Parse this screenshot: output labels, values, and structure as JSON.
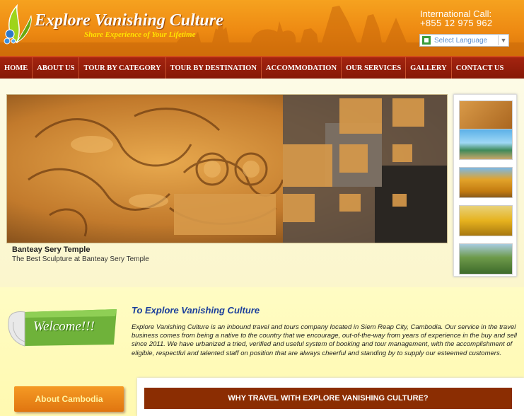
{
  "header": {
    "logo_title": "Explore Vanishing Culture",
    "tagline": "Share Experience of Your Lifetime",
    "intl_call_label": "International Call:",
    "intl_phone": "+855 12 975 962",
    "language_select_label": "Select Language"
  },
  "nav": {
    "items": [
      "HOME",
      "ABOUT US",
      "TOUR BY CATEGORY",
      "TOUR BY DESTINATION",
      "ACCOMMODATION",
      "OUR SERVICES",
      "GALLERY",
      "CONTACT US"
    ]
  },
  "slideshow": {
    "caption_title": "Banteay Sery Temple",
    "caption_subtitle": "The Best Sculpture at Banteay Sery Temple",
    "thumbnails": [
      "sculpture",
      "beach",
      "pagoda",
      "reclining-buddha",
      "green-hills"
    ]
  },
  "welcome": {
    "badge_text": "Welcome!!!",
    "title": "To Explore Vanishing Culture",
    "body": "Explore Vanishing Culture is an inbound travel and tours company located in Siem Reap City, Cambodia. Our service in the travel business comes from being a native to the country that we encourage, out-of-the-way from years of experience in the buy and sell since 2011. We have urbanized a tried, verified and useful system of booking and tour management, with the accomplishment of eligible, respectful and talented staff on position that are always cheerful and standing by to supply our esteemed customers."
  },
  "sidebar": {
    "about_cambodia_label": "About Cambodia"
  },
  "why_travel": {
    "title": "WHY TRAVEL WITH EXPLORE VANISHING CULTURE?"
  },
  "colors": {
    "header_orange": "#ee8a12",
    "nav_red": "#8b1a06",
    "title_blue": "#1b3f9b",
    "why_header_brown": "#8b2d02"
  }
}
